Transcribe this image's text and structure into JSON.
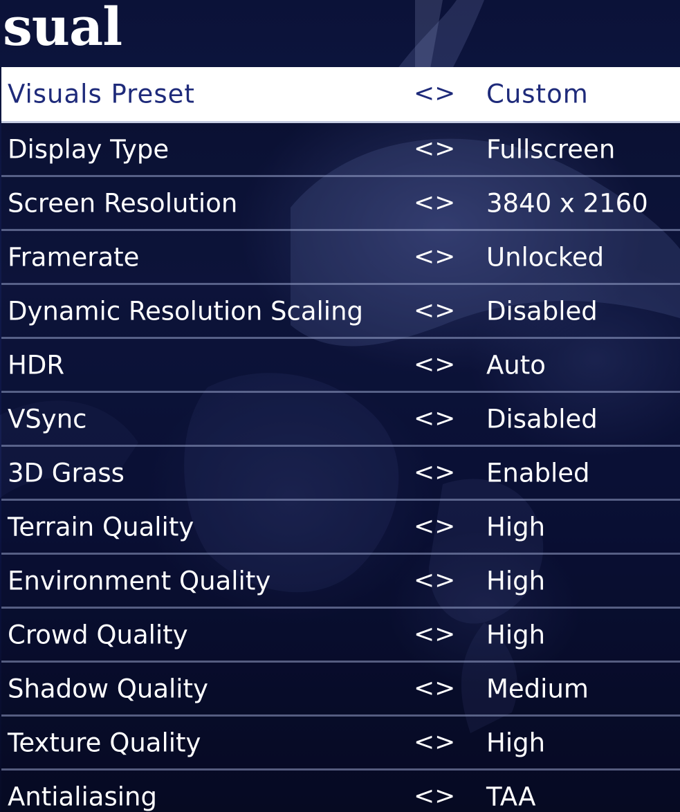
{
  "page": {
    "title": "sual"
  },
  "colors": {
    "background": "#0b1238",
    "selected_row_bg": "#ffffff",
    "selected_text": "#1e2a7a",
    "text": "#ffffff"
  },
  "settings": {
    "arrow_left": "<",
    "arrow_right": ">",
    "rows": [
      {
        "label": "Visuals Preset",
        "value": "Custom",
        "selected": true
      },
      {
        "label": "Display Type",
        "value": "Fullscreen"
      },
      {
        "label": "Screen Resolution",
        "value": "3840 x 2160"
      },
      {
        "label": "Framerate",
        "value": "Unlocked"
      },
      {
        "label": "Dynamic Resolution Scaling",
        "value": "Disabled"
      },
      {
        "label": "HDR",
        "value": "Auto"
      },
      {
        "label": "VSync",
        "value": "Disabled"
      },
      {
        "label": "3D Grass",
        "value": "Enabled"
      },
      {
        "label": "Terrain Quality",
        "value": "High"
      },
      {
        "label": "Environment Quality",
        "value": "High"
      },
      {
        "label": "Crowd Quality",
        "value": "High"
      },
      {
        "label": "Shadow Quality",
        "value": "Medium"
      },
      {
        "label": "Texture Quality",
        "value": "High"
      },
      {
        "label": "Antialiasing",
        "value": "TAA"
      }
    ]
  }
}
